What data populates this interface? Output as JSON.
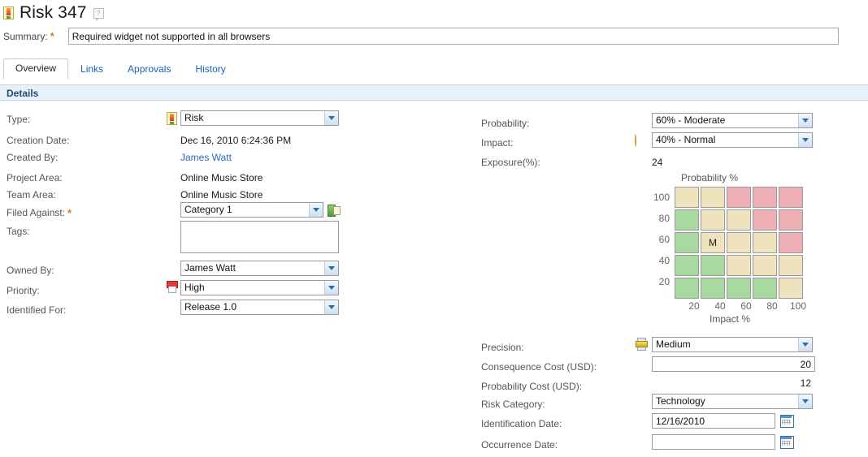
{
  "header": {
    "title": "Risk 347",
    "type_icon": "risk-icon",
    "help_icon": "help-icon"
  },
  "summary": {
    "label": "Summary:",
    "required": true,
    "value": "Required widget not supported in all browsers",
    "placeholder": ""
  },
  "tabs": [
    {
      "label": "Overview",
      "active": true
    },
    {
      "label": "Links",
      "active": false
    },
    {
      "label": "Approvals",
      "active": false
    },
    {
      "label": "History",
      "active": false
    }
  ],
  "section": {
    "details_label": "Details"
  },
  "left_fields": {
    "type": {
      "label": "Type:",
      "value": "Risk",
      "icon": "risk-icon"
    },
    "creation_date": {
      "label": "Creation Date:",
      "value": "Dec 16, 2010 6:24:36 PM"
    },
    "created_by": {
      "label": "Created By:",
      "value": "James Watt"
    },
    "project_area": {
      "label": "Project Area:",
      "value": "Online Music Store"
    },
    "team_area": {
      "label": "Team Area:",
      "value": "Online Music Store"
    },
    "filed_against": {
      "label": "Filed Against:",
      "value": "Category 1",
      "required": true,
      "icon": "category-icon"
    },
    "tags": {
      "label": "Tags:",
      "value": "",
      "placeholder": ""
    },
    "owned_by": {
      "label": "Owned By:",
      "value": "James Watt"
    },
    "priority": {
      "label": "Priority:",
      "value": "High",
      "icon": "priority-high-icon"
    },
    "identified_for": {
      "label": "Identified For:",
      "value": "Release 1.0"
    }
  },
  "right_fields": {
    "probability": {
      "label": "Probability:",
      "value": "60% - Moderate"
    },
    "impact": {
      "label": "Impact:",
      "value": "40% - Normal",
      "icon": "impact-normal-icon"
    },
    "exposure": {
      "label": "Exposure(%):",
      "value": "24"
    },
    "precision": {
      "label": "Precision:",
      "value": "Medium",
      "icon": "precision-medium-icon"
    },
    "consequence_cost": {
      "label": "Consequence Cost (USD):",
      "value": "20",
      "placeholder": ""
    },
    "probability_cost": {
      "label": "Probability Cost (USD):",
      "value": "12"
    },
    "risk_category": {
      "label": "Risk Category:",
      "value": "Technology"
    },
    "identification_date": {
      "label": "Identification Date:",
      "value": "12/16/2010",
      "placeholder": ""
    },
    "occurrence_date": {
      "label": "Occurrence Date:",
      "value": "",
      "placeholder": ""
    }
  },
  "chart_data": {
    "type": "heatmap",
    "title": "Probability %",
    "xlabel": "Impact %",
    "ylabel": "Probability %",
    "x_ticks": [
      "20",
      "40",
      "60",
      "80",
      "100"
    ],
    "y_ticks": [
      "100",
      "80",
      "60",
      "40",
      "20"
    ],
    "marker": {
      "label": "M",
      "probability": 60,
      "impact": 40
    },
    "colors": {
      "low": "#a8d9a0",
      "medium": "#eee3bc",
      "high": "#eeb0b4"
    },
    "cells": [
      [
        {
          "level": "medium",
          "label": ""
        },
        {
          "level": "medium",
          "label": ""
        },
        {
          "level": "high",
          "label": ""
        },
        {
          "level": "high",
          "label": ""
        },
        {
          "level": "high",
          "label": ""
        }
      ],
      [
        {
          "level": "low",
          "label": ""
        },
        {
          "level": "medium",
          "label": ""
        },
        {
          "level": "medium",
          "label": ""
        },
        {
          "level": "high",
          "label": ""
        },
        {
          "level": "high",
          "label": ""
        }
      ],
      [
        {
          "level": "low",
          "label": ""
        },
        {
          "level": "medium",
          "label": "M"
        },
        {
          "level": "medium",
          "label": ""
        },
        {
          "level": "medium",
          "label": ""
        },
        {
          "level": "high",
          "label": ""
        }
      ],
      [
        {
          "level": "low",
          "label": ""
        },
        {
          "level": "low",
          "label": ""
        },
        {
          "level": "medium",
          "label": ""
        },
        {
          "level": "medium",
          "label": ""
        },
        {
          "level": "medium",
          "label": ""
        }
      ],
      [
        {
          "level": "low",
          "label": ""
        },
        {
          "level": "low",
          "label": ""
        },
        {
          "level": "low",
          "label": ""
        },
        {
          "level": "low",
          "label": ""
        },
        {
          "level": "medium",
          "label": ""
        }
      ]
    ]
  }
}
